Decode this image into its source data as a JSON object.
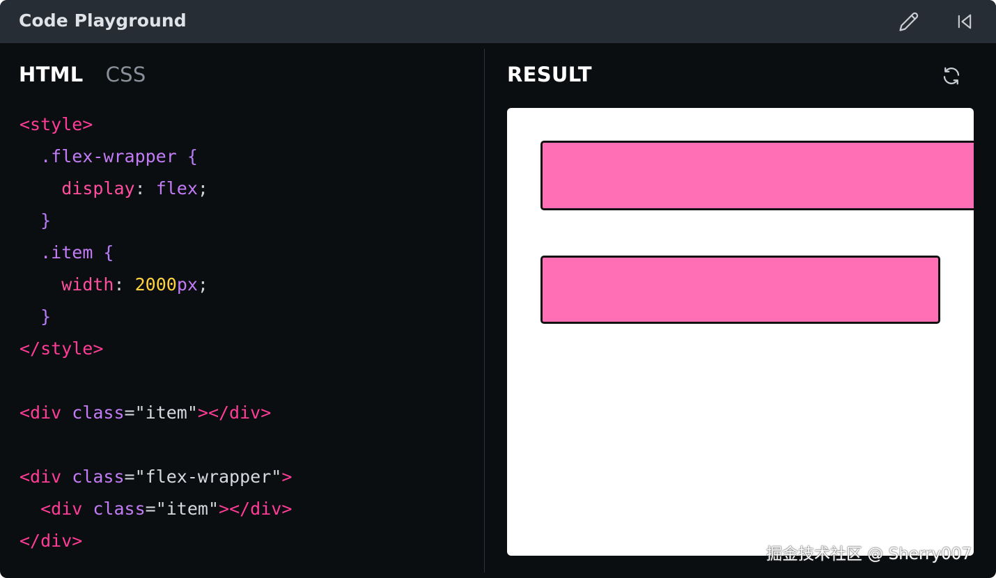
{
  "window": {
    "title": "Code Playground"
  },
  "tabs": [
    {
      "label": "HTML",
      "active": true
    },
    {
      "label": "CSS",
      "active": false
    }
  ],
  "code_lines": [
    [
      {
        "t": "tag",
        "v": "<style>"
      }
    ],
    [
      {
        "t": "plain",
        "v": "  "
      },
      {
        "t": "sel",
        "v": ".flex-wrapper"
      },
      {
        "t": "brace",
        "v": " {"
      }
    ],
    [
      {
        "t": "plain",
        "v": "    "
      },
      {
        "t": "prop",
        "v": "display"
      },
      {
        "t": "punct",
        "v": ": "
      },
      {
        "t": "val",
        "v": "flex"
      },
      {
        "t": "punct",
        "v": ";"
      }
    ],
    [
      {
        "t": "plain",
        "v": "  "
      },
      {
        "t": "brace",
        "v": "}"
      }
    ],
    [
      {
        "t": "plain",
        "v": "  "
      },
      {
        "t": "sel",
        "v": ".item"
      },
      {
        "t": "brace",
        "v": " {"
      }
    ],
    [
      {
        "t": "plain",
        "v": "    "
      },
      {
        "t": "prop",
        "v": "width"
      },
      {
        "t": "punct",
        "v": ": "
      },
      {
        "t": "num",
        "v": "2000"
      },
      {
        "t": "unit",
        "v": "px"
      },
      {
        "t": "punct",
        "v": ";"
      }
    ],
    [
      {
        "t": "plain",
        "v": "  "
      },
      {
        "t": "brace",
        "v": "}"
      }
    ],
    [
      {
        "t": "tag",
        "v": "</style>"
      }
    ],
    [],
    [
      {
        "t": "tag",
        "v": "<div "
      },
      {
        "t": "attr",
        "v": "class"
      },
      {
        "t": "punct",
        "v": "="
      },
      {
        "t": "str",
        "v": "\"item\""
      },
      {
        "t": "tag",
        "v": "></div>"
      }
    ],
    [],
    [
      {
        "t": "tag",
        "v": "<div "
      },
      {
        "t": "attr",
        "v": "class"
      },
      {
        "t": "punct",
        "v": "="
      },
      {
        "t": "str",
        "v": "\"flex-wrapper\""
      },
      {
        "t": "tag",
        "v": ">"
      }
    ],
    [
      {
        "t": "plain",
        "v": "  "
      },
      {
        "t": "tag",
        "v": "<div "
      },
      {
        "t": "attr",
        "v": "class"
      },
      {
        "t": "punct",
        "v": "="
      },
      {
        "t": "str",
        "v": "\"item\""
      },
      {
        "t": "tag",
        "v": "></div>"
      }
    ],
    [
      {
        "t": "tag",
        "v": "</div>"
      }
    ]
  ],
  "result": {
    "title": "RESULT"
  },
  "colors": {
    "titlebar": "#272d35",
    "background": "#0b0e11",
    "item_fill": "#ff6fb5",
    "tag": "#ff3d96",
    "selector": "#c27cf5",
    "number": "#ffd23f"
  },
  "icons": {
    "edit": "pencil-icon",
    "collapse": "skip-back-icon",
    "refresh": "refresh-icon"
  },
  "watermark": "掘金技术社区 @ Sherry007"
}
